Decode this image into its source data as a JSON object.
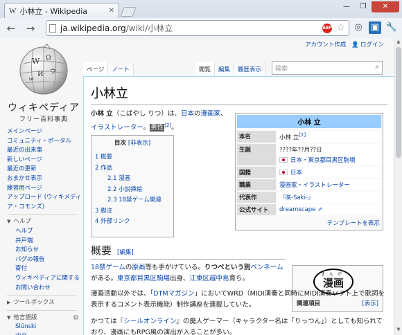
{
  "browser": {
    "tab_icon": "W",
    "tab_title": "小林立 - Wikipedia",
    "url_host": "ja.wikipedia.org",
    "url_path": "/wiki/小林立"
  },
  "personal": {
    "create_account": "アカウント作成",
    "login": "ログイン"
  },
  "logo": {
    "name": "ウィキペディア",
    "tagline": "フリー百科事典"
  },
  "tabs": {
    "page": "ページ",
    "note": "ノート",
    "read": "閲覧",
    "edit": "編集",
    "history": "履歴表示",
    "search_placeholder": "検索"
  },
  "sidebar": {
    "nav": [
      "メインページ",
      "コミュニティ・ポータル",
      "最近の出来事",
      "新しいページ",
      "最近の更新",
      "おまかせ表示",
      "練習用ページ",
      "アップロード (ウィキメディア・コモンズ)"
    ],
    "help_heading": "ヘルプ",
    "help": [
      "ヘルプ",
      "井戸端",
      "お知らせ",
      "バグの報告",
      "寄付",
      "ウィキペディアに関するお問い合わせ"
    ],
    "toolbox_heading": "ツールボックス",
    "lang_heading": "他言語版",
    "langs": [
      "Slūnski",
      "中文"
    ]
  },
  "article": {
    "title": "小林立",
    "lead": {
      "name": "小林 立",
      "reading": "（こばやし りつ）は、",
      "japan": "日本",
      "no": "の",
      "manga_artist": "漫画家",
      "sep": "、",
      "illustrator": "イラストレーター",
      "period": "。",
      "gender": "男性",
      "ref": "[2]",
      "end": "。"
    },
    "toc": {
      "heading": "目次",
      "toggle": "[非表示]",
      "items": [
        "1 概要",
        "2 作品",
        "2.1 漫画",
        "2.2 小説挿絵",
        "2.3 18禁ゲーム関連",
        "3 脚注",
        "4 外部リンク"
      ]
    },
    "infobox": {
      "title": "小林 立",
      "rows": [
        {
          "label": "本名",
          "value": "小林 立",
          "ref": "[1]"
        },
        {
          "label": "生誕",
          "value": "????年??月??日",
          "value2": "日本・東京都目黒区駒場"
        },
        {
          "label": "国籍",
          "value": "日本"
        },
        {
          "label": "職業",
          "value": "漫画家・イラストレーター"
        },
        {
          "label": "代表作",
          "value": "『咲-Saki-』"
        },
        {
          "label": "公式サイト",
          "value": "dreamscape"
        }
      ],
      "template_link": "テンプレートを表示"
    },
    "manga_box": {
      "ruby": "まんが",
      "kanji": "漫画",
      "label": "関連項目",
      "show": "[表示]"
    },
    "section": {
      "heading": "概要",
      "edit": "[編集]"
    },
    "para1": {
      "a1": "18禁ゲーム",
      "t1": "の",
      "a2": "原画",
      "t2": "等も手がけている。",
      "b1": "りつべという別",
      "a3": "ペンネーム",
      "t3": "がある。",
      "a4": "東京都目黒区駒場",
      "t4": "出身、",
      "a5": "江東区越中島",
      "t5": "育ち。"
    },
    "para2": {
      "t1": "漫画活動以外では、「",
      "a1": "DTMマガジン",
      "t2": "」においてWRD（MIDI演奏と同時にMIDI演奏ソフト上で歌詞を表示するコメント表示機能）制作講座を連載していた。"
    },
    "para3": {
      "t1": "かつては『",
      "a1": "シールオンライン",
      "t2": "』の廃人ゲーマー（キャラクター名は「りっつん」）としても知られており、漫画にもRPG風の演出が入ることが多い。"
    }
  }
}
